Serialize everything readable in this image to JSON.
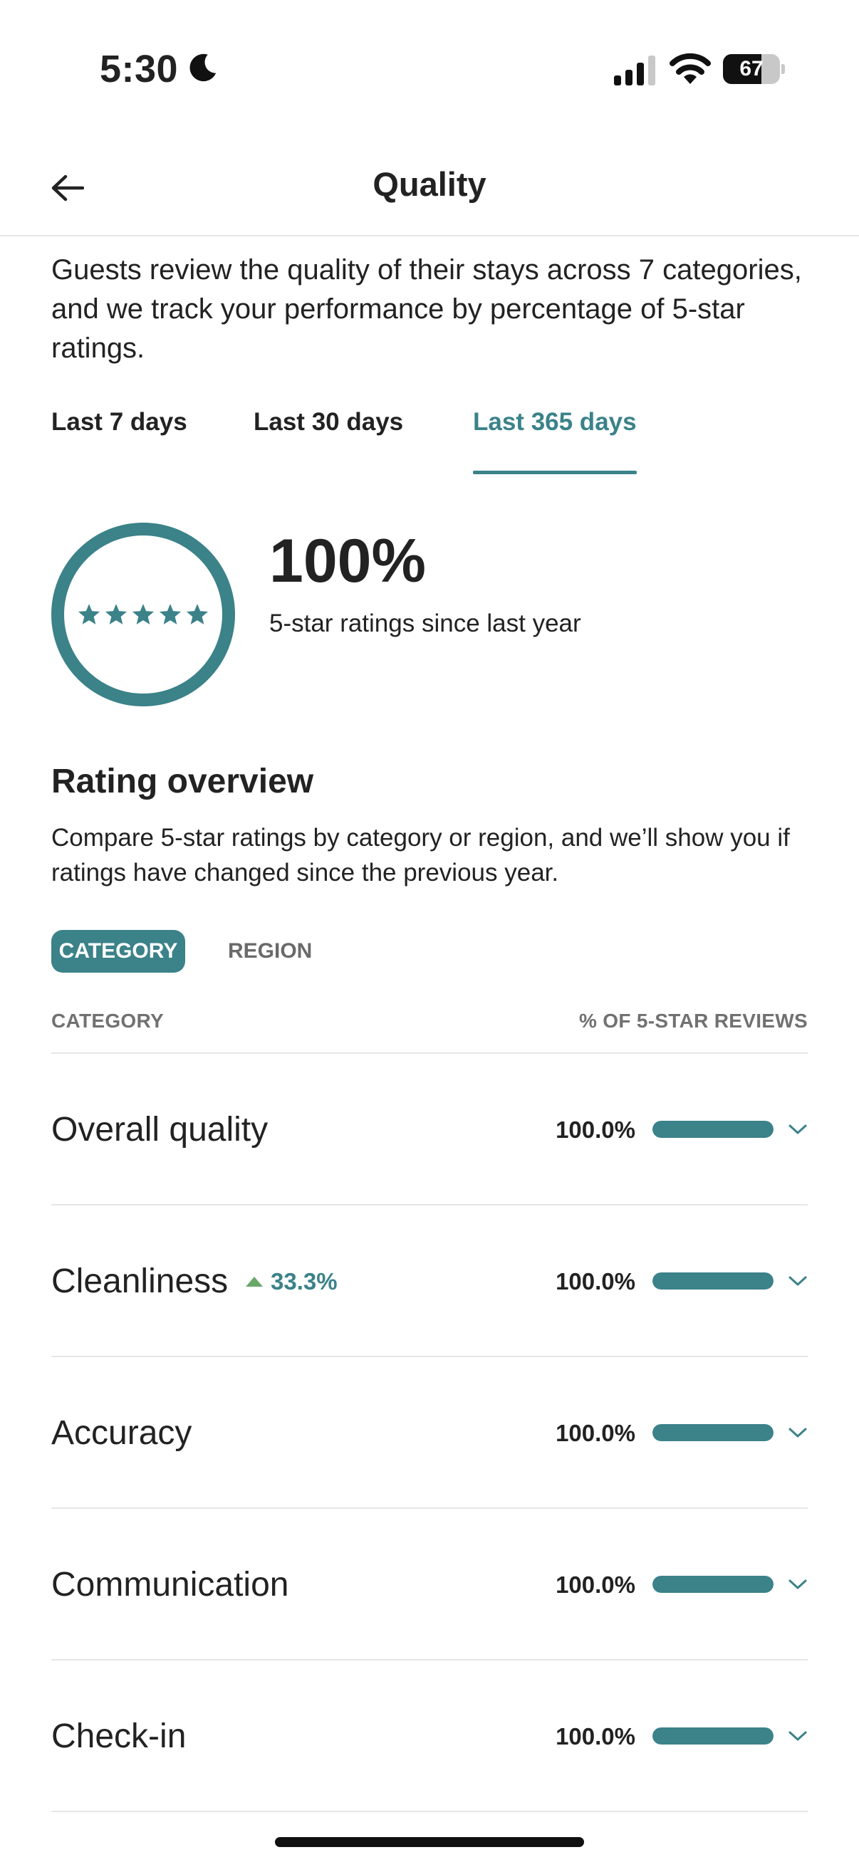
{
  "status_bar": {
    "time": "5:30",
    "battery": "67",
    "battery_level": 0.67
  },
  "header": {
    "title": "Quality"
  },
  "intro": "Guests review the quality of their stays across 7 categories, and we track your performance by percentage of 5-star ratings.",
  "period_tabs": [
    {
      "label": "Last 7 days",
      "active": false
    },
    {
      "label": "Last 30 days",
      "active": false
    },
    {
      "label": "Last 365 days",
      "active": true
    }
  ],
  "summary": {
    "percent": "100%",
    "caption": "5-star ratings since last year",
    "stars": 5
  },
  "overview": {
    "title": "Rating overview",
    "description": "Compare 5-star ratings by category or region, and we’ll show you if ratings have changed since the previous year.",
    "toggle": {
      "active": "CATEGORY",
      "inactive": "REGION"
    },
    "columns": {
      "left": "CATEGORY",
      "right": "% OF 5-STAR REVIEWS"
    },
    "rows": [
      {
        "label": "Overall quality",
        "value": "100.0%",
        "fill": 1.0,
        "delta": ""
      },
      {
        "label": "Cleanliness",
        "value": "100.0%",
        "fill": 1.0,
        "delta": "33.3%"
      },
      {
        "label": "Accuracy",
        "value": "100.0%",
        "fill": 1.0,
        "delta": ""
      },
      {
        "label": "Communication",
        "value": "100.0%",
        "fill": 1.0,
        "delta": ""
      },
      {
        "label": "Check-in",
        "value": "100.0%",
        "fill": 1.0,
        "delta": ""
      }
    ]
  },
  "colors": {
    "accent": "#3b8289",
    "text": "#222222",
    "muted": "#717171",
    "divider": "#e6e6e6"
  }
}
